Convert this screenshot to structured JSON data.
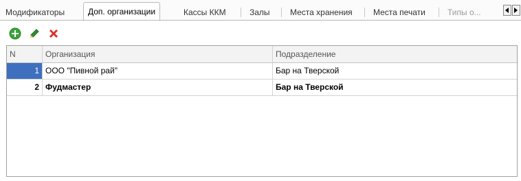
{
  "tabs": [
    {
      "label": "Модификаторы",
      "state": "normal"
    },
    {
      "label": "Доп. организации",
      "state": "active"
    },
    {
      "label": "Кассы ККМ",
      "state": "normal"
    },
    {
      "label": "Залы",
      "state": "normal"
    },
    {
      "label": "Места хранения",
      "state": "normal"
    },
    {
      "label": "Места печати",
      "state": "normal"
    },
    {
      "label": "Типы о...",
      "state": "disabled"
    }
  ],
  "toolbar": {
    "add_icon": "add-icon",
    "edit_icon": "pencil-icon",
    "delete_icon": "delete-icon"
  },
  "table": {
    "columns": [
      "N",
      "Организация",
      "Подразделение"
    ],
    "rows": [
      {
        "n": "1",
        "org": "ООО \"Пивной рай\"",
        "dept": "Бар на Тверской",
        "selected": true,
        "bold": false
      },
      {
        "n": "2",
        "org": "Фудмастер",
        "dept": "Бар на Тверской",
        "selected": false,
        "bold": true
      }
    ]
  },
  "colors": {
    "selection": "#3f6fbf",
    "add_green": "#3aa43a",
    "edit_green": "#2f8f2f",
    "delete_red": "#d9342b"
  }
}
